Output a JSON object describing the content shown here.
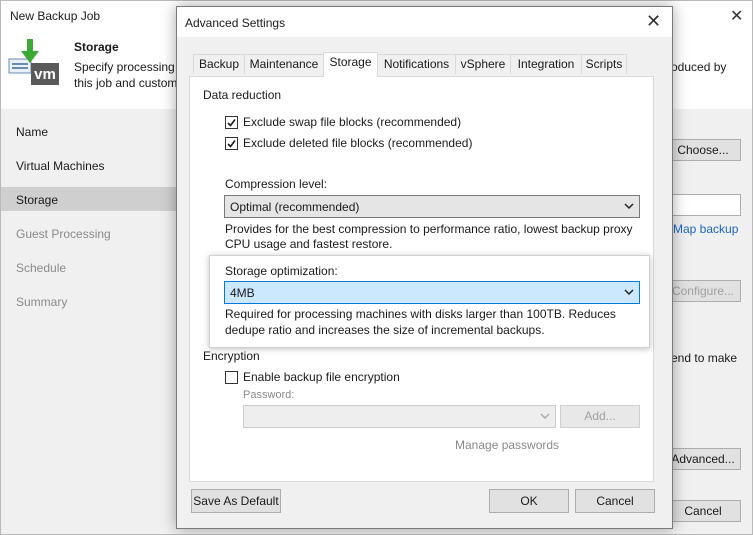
{
  "background": {
    "title": "New Backup Job",
    "header": {
      "title": "Storage",
      "desc_line1": "Specify processing",
      "desc_line2": "this job and custom",
      "desc_right": "roduced by",
      "icon_text": "vm"
    },
    "nav": [
      "Name",
      "Virtual Machines",
      "Storage",
      "Guest Processing",
      "Schedule",
      "Summary"
    ],
    "selected_nav": "Storage",
    "buttons": {
      "choose": "Choose...",
      "configure": "Configure...",
      "advanced": "Advanced...",
      "cancel": "Cancel"
    },
    "map_backup_link": "Map backup",
    "side_text": "end to make"
  },
  "dialog": {
    "title": "Advanced Settings",
    "tabs": [
      "Backup",
      "Maintenance",
      "Storage",
      "Notifications",
      "vSphere",
      "Integration",
      "Scripts"
    ],
    "active_tab": "Storage",
    "data_reduction": {
      "heading": "Data reduction",
      "exclude_swap": {
        "label": "Exclude swap file blocks (recommended)",
        "checked": true
      },
      "exclude_deleted": {
        "label": "Exclude deleted file blocks (recommended)",
        "checked": true
      }
    },
    "compression": {
      "label": "Compression level:",
      "value": "Optimal (recommended)",
      "desc_line1": "Provides for the best compression to performance ratio, lowest backup proxy",
      "desc_line2": "CPU usage and fastest restore."
    },
    "storage_optimization": {
      "label": "Storage optimization:",
      "value": "4MB",
      "desc_line1": "Required for processing machines with disks larger than 100TB. Reduces",
      "desc_line2": "dedupe ratio and increases the size of incremental backups."
    },
    "encryption": {
      "heading": "Encryption",
      "enable_label": "Enable backup file encryption",
      "enabled": false,
      "password_label": "Password:",
      "password_value": "",
      "add_label": "Add...",
      "manage_link": "Manage passwords"
    },
    "buttons": {
      "save_default": "Save As Default",
      "ok": "OK",
      "cancel": "Cancel"
    }
  },
  "colors": {
    "selection": "#cce8ff",
    "selection_border": "#0078d7",
    "link": "#1a66c2",
    "icon_green": "#3aaa35",
    "icon_gray": "#5a5a5a"
  }
}
